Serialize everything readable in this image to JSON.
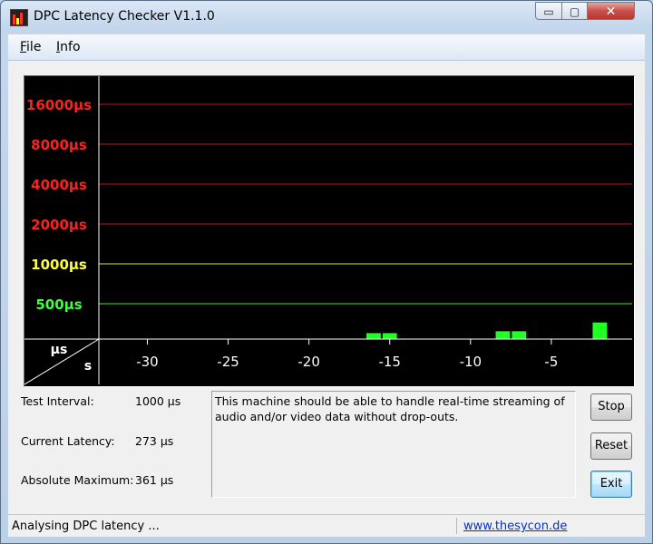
{
  "window": {
    "title": "DPC Latency Checker V1.1.0",
    "controls": {
      "minimize": "▭",
      "maximize": "▢",
      "close": "✕"
    }
  },
  "menu": {
    "items": [
      "File",
      "Info"
    ]
  },
  "chart_data": {
    "type": "bar",
    "title": "",
    "ylabel": "µs",
    "xlabel": "s",
    "y_tick_labels": [
      "16000µs",
      "8000µs",
      "4000µs",
      "2000µs",
      "1000µs",
      "500µs"
    ],
    "y_tick_values": [
      16000,
      8000,
      4000,
      2000,
      1000,
      500
    ],
    "y_tick_colors": [
      "#ff2020",
      "#ff2020",
      "#ff2020",
      "#ff2020",
      "#ffff40",
      "#40ff40"
    ],
    "y_scale": "log2",
    "x_ticks": [
      -30,
      -25,
      -20,
      -15,
      -10,
      -5
    ],
    "xlim": [
      -33,
      0
    ],
    "bar_color": "#22ff22",
    "x": [
      -32,
      -31,
      -30,
      -29,
      -28,
      -27,
      -26,
      -25,
      -24,
      -23,
      -22,
      -21,
      -20,
      -19,
      -18,
      -17,
      -16,
      -15,
      -14,
      -13,
      -12,
      -11,
      -10,
      -9,
      -8,
      -7,
      -6,
      -5,
      -4,
      -3,
      -2,
      -1
    ],
    "values": [
      260,
      260,
      250,
      250,
      250,
      250,
      250,
      250,
      260,
      240,
      240,
      270,
      270,
      270,
      250,
      250,
      300,
      300,
      250,
      240,
      240,
      270,
      260,
      260,
      310,
      310,
      260,
      270,
      260,
      270,
      361,
      260
    ]
  },
  "info": {
    "test_interval_label": "Test Interval:",
    "test_interval_value": "1000 µs",
    "current_latency_label": "Current Latency:",
    "current_latency_value": "273 µs",
    "absolute_maximum_label": "Absolute Maximum:",
    "absolute_maximum_value": "361 µs"
  },
  "message": "This machine should be able to handle real-time streaming of audio and/or video data without drop-outs.",
  "buttons": {
    "stop": "Stop",
    "reset": "Reset",
    "exit": "Exit"
  },
  "status": {
    "text": "Analysing DPC latency ...",
    "link": "www.thesycon.de"
  }
}
